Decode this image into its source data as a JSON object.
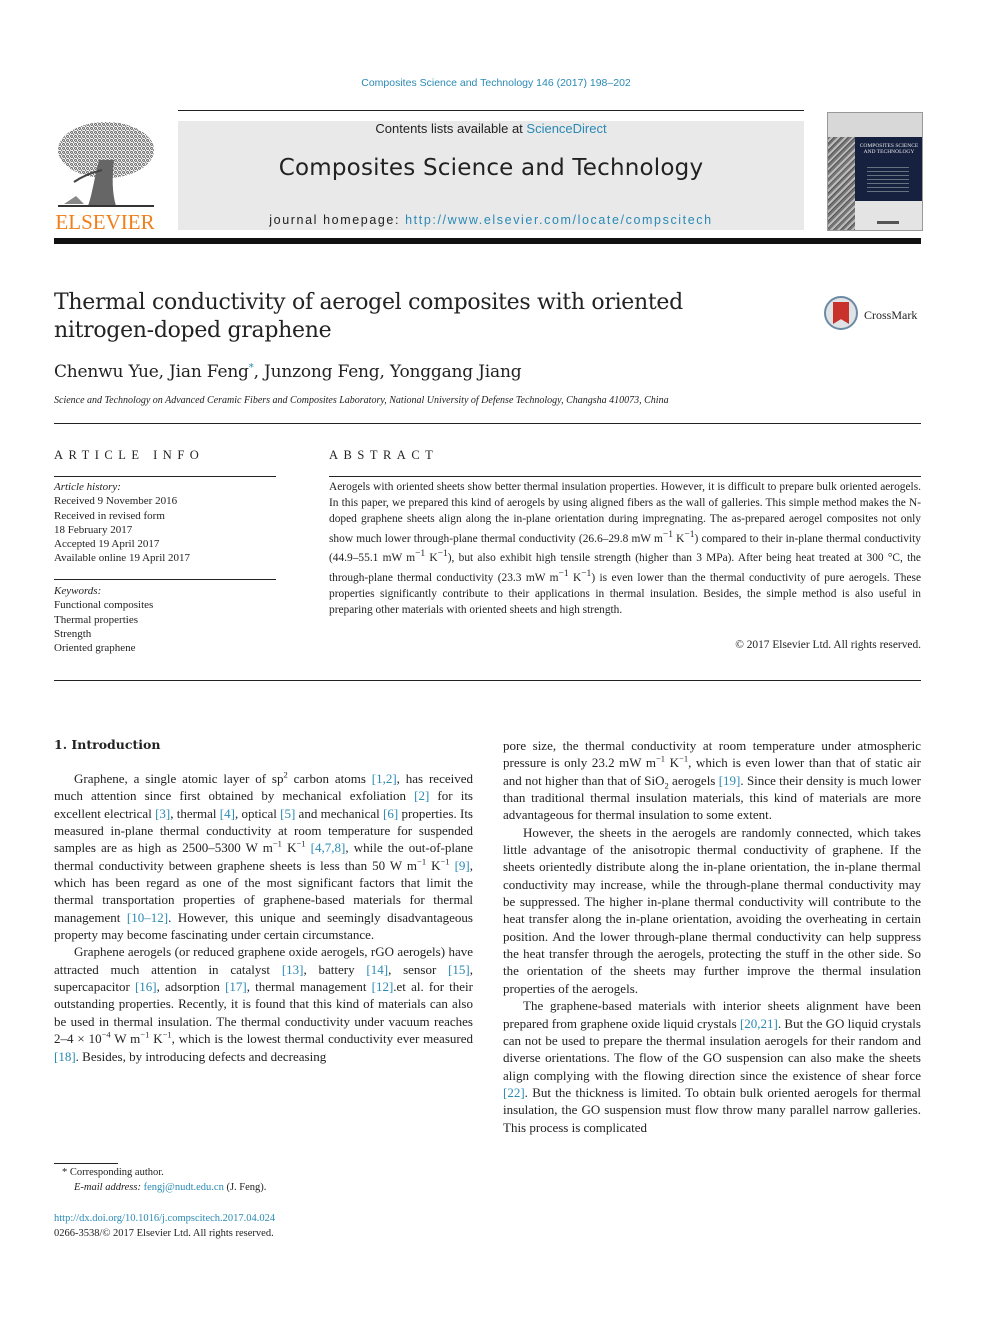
{
  "header": {
    "citation": "Composites Science and Technology 146 (2017) 198–202",
    "contents_prefix": "Contents lists available at ",
    "contents_link": "ScienceDirect",
    "journal_title": "Composites Science and Technology",
    "homepage_prefix": "journal homepage: ",
    "homepage_url": "http://www.elsevier.com/locate/compscitech",
    "publisher_logo_text": "ELSEVIER",
    "cover_title": "COMPOSITES SCIENCE AND TECHNOLOGY",
    "crossmark_label": "CrossMark"
  },
  "article": {
    "title_line1": "Thermal conductivity of aerogel composites with oriented",
    "title_line2": "nitrogen-doped graphene",
    "authors": [
      {
        "name": "Chenwu Yue",
        "sep": ", "
      },
      {
        "name": "Jian Feng",
        "mark": "*",
        "sep": ", "
      },
      {
        "name": "Junzong Feng",
        "sep": ", "
      },
      {
        "name": "Yonggang Jiang",
        "sep": ""
      }
    ],
    "affiliation": "Science and Technology on Advanced Ceramic Fibers and Composites Laboratory, National University of Defense Technology, Changsha 410073, China"
  },
  "article_info": {
    "heading": "ARTICLE INFO",
    "history_label": "Article history:",
    "history": [
      "Received 9 November 2016",
      "Received in revised form",
      "18 February 2017",
      "Accepted 19 April 2017",
      "Available online 19 April 2017"
    ],
    "keywords_label": "Keywords:",
    "keywords": [
      "Functional composites",
      "Thermal properties",
      "Strength",
      "Oriented graphene"
    ]
  },
  "abstract": {
    "heading": "ABSTRACT",
    "s1": "Aerogels with oriented sheets show better thermal insulation properties. However, it is difficult to prepare bulk oriented aerogels. In this paper, we prepared this kind of aerogels by using aligned fibers as the wall of galleries. This simple method makes the N-doped graphene sheets align along the in-plane orientation during impregnating. The as-prepared aerogel composites not only show much lower through-plane thermal conductivity (26.6–29.8 mW m",
    "s2": " K",
    "s3": ") compared to their in-plane thermal conductivity (44.9–55.1 mW m",
    "s4": " K",
    "s5": "), but also exhibit high tensile strength (higher than 3 MPa). After being heat treated at 300 °C, the through-plane thermal conductivity (23.3 mW m",
    "s6": " K",
    "s7": ") is even lower than the thermal conductivity of pure aerogels. These properties significantly contribute to their applications in thermal insulation. Besides, the simple method is also useful in preparing other materials with oriented sheets and high strength.",
    "exp": "−1",
    "copyright": "© 2017 Elsevier Ltd. All rights reserved."
  },
  "intro": {
    "heading": "1.  Introduction",
    "p1": {
      "a": "Graphene, a single atomic layer of sp",
      "sup": "2",
      "b": " carbon atoms ",
      "r1": "[1,2]",
      "c": ", has received much attention since first obtained by mechanical exfoliation ",
      "r2": "[2]",
      "d": " for its excellent electrical ",
      "r3": "[3]",
      "e": ", thermal ",
      "r4": "[4]",
      "f": ", optical ",
      "r5": "[5]",
      "g": " and mechanical ",
      "r6": "[6]",
      "h": " properties. Its measured in-plane thermal conductivity at room temperature for suspended samples are as high as 2500–5300 W m",
      "i": " K",
      "j": " ",
      "r7": "[4,7,8]",
      "k": ", while the out-of-plane thermal conductivity between graphene sheets is less than 50 W m",
      "l": " K",
      "m": " ",
      "r8": "[9]",
      "n": ", which has been regard as one of the most significant factors that limit the thermal transportation properties of graphene-based materials for thermal management ",
      "r9": "[10–12]",
      "o": ". However, this unique and seemingly disadvantageous property may become fascinating under certain circumstance."
    },
    "p2": {
      "a": "Graphene aerogels (or reduced graphene oxide aerogels, rGO aerogels) have attracted much attention in catalyst ",
      "r1": "[13]",
      "b": ", battery ",
      "r2": "[14]",
      "c": ", sensor ",
      "r3": "[15]",
      "d": ", supercapacitor ",
      "r4": "[16]",
      "e": ", adsorption ",
      "r5": "[17]",
      "f": ", thermal management ",
      "r6": "[12]",
      "g": ".et al. for their outstanding properties. Recently, it is found that this kind of materials can also be used in thermal insulation. The thermal conductivity under vacuum reaches 2–4 × 10",
      "exp4": "−4",
      "h": " W m",
      "i": " K",
      "j": ", which is the lowest thermal conductivity ever measured ",
      "r7": "[18]",
      "k": ". Besides, by introducing defects and decreasing"
    },
    "p2_cont": {
      "a": "pore size, the thermal conductivity at room temperature under atmospheric pressure is only 23.2 mW m",
      "b": " K",
      "c": ", which is even lower than that of static air and not higher than that of SiO",
      "sub": "2",
      "d": " aerogels ",
      "r1": "[19]",
      "e": ". Since their density is much lower than traditional thermal insulation materials, this kind of materials are more advantageous for thermal insulation to some extent."
    },
    "p3": "However, the sheets in the aerogels are randomly connected, which takes little advantage of the anisotropic thermal conductivity of graphene. If the sheets orientedly distribute along the in-plane orientation, the in-plane thermal conductivity may increase, while the through-plane thermal conductivity may be suppressed. The higher in-plane thermal conductivity will contribute to the heat transfer along the in-plane orientation, avoiding the overheating in certain position. And the lower through-plane thermal conductivity can help suppress the heat transfer through the aerogels, protecting the stuff in the other side. So the orientation of the sheets may further improve the thermal insulation properties of the aerogels.",
    "p4": {
      "a": "The graphene-based materials with interior sheets alignment have been prepared from graphene oxide liquid crystals ",
      "r1": "[20,21]",
      "b": ". But the GO liquid crystals can not be used to prepare the thermal insulation aerogels for their random and diverse orientations. The flow of the GO suspension can also make the sheets align complying with the flowing direction since the existence of shear force ",
      "r2": "[22]",
      "c": ". But the thickness is limited. To obtain bulk oriented aerogels for thermal insulation, the GO suspension must flow throw many parallel narrow galleries. This process is complicated"
    }
  },
  "footnote": {
    "mark": "*",
    "corresponding": " Corresponding author.",
    "email_label": "E-mail address:",
    "email": "fengj@nudt.edu.cn",
    "email_suffix": " (J. Feng).",
    "doi": "http://dx.doi.org/10.1016/j.compscitech.2017.04.024",
    "issn_line": "0266-3538/© 2017 Elsevier Ltd. All rights reserved."
  },
  "colors": {
    "link": "#2a8ab5",
    "elsevier_orange": "#f07f1b",
    "banner_bg": "#e9e9e9",
    "crossmark_red": "#c8322a"
  }
}
